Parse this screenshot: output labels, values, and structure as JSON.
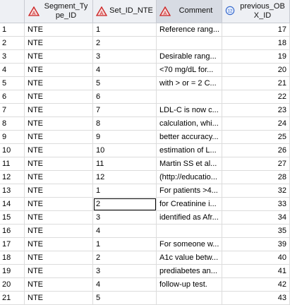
{
  "columns": [
    {
      "label": "Segment_Type_ID",
      "line1": "Segment_Ty",
      "line2": "pe_ID",
      "icon": "triangle-char-icon",
      "icon_color": "#cc2222"
    },
    {
      "label": "Set_ID_NTE",
      "line1": "Set_ID_NTE",
      "line2": "",
      "icon": "triangle-char-icon",
      "icon_color": "#cc2222"
    },
    {
      "label": "Comment",
      "line1": "Comment",
      "line2": "",
      "icon": "triangle-char-icon",
      "icon_color": "#cc2222"
    },
    {
      "label": "previous_OBX_ID",
      "line1": "previous_OB",
      "line2": "X_ID",
      "icon": "numeric-icon",
      "icon_color": "#3366cc"
    }
  ],
  "rows": [
    {
      "n": "1",
      "seg": "NTE",
      "set": "1",
      "comment": "Reference rang...",
      "prev": "17"
    },
    {
      "n": "2",
      "seg": "NTE",
      "set": "2",
      "comment": "",
      "prev": "18"
    },
    {
      "n": "3",
      "seg": "NTE",
      "set": "3",
      "comment": "Desirable rang...",
      "prev": "19"
    },
    {
      "n": "4",
      "seg": "NTE",
      "set": "4",
      "comment": "<70 mg/dL for...",
      "prev": "20"
    },
    {
      "n": "5",
      "seg": "NTE",
      "set": "5",
      "comment": "with > or = 2 C...",
      "prev": "21"
    },
    {
      "n": "6",
      "seg": "NTE",
      "set": "6",
      "comment": "",
      "prev": "22"
    },
    {
      "n": "7",
      "seg": "NTE",
      "set": "7",
      "comment": "LDL-C is now c...",
      "prev": "23"
    },
    {
      "n": "8",
      "seg": "NTE",
      "set": "8",
      "comment": "calculation, whi...",
      "prev": "24"
    },
    {
      "n": "9",
      "seg": "NTE",
      "set": "9",
      "comment": "better accuracy...",
      "prev": "25"
    },
    {
      "n": "10",
      "seg": "NTE",
      "set": "10",
      "comment": "estimation of L...",
      "prev": "26"
    },
    {
      "n": "11",
      "seg": "NTE",
      "set": "11",
      "comment": "Martin SS et al...",
      "prev": "27"
    },
    {
      "n": "12",
      "seg": "NTE",
      "set": "12",
      "comment": "(http://educatio...",
      "prev": "28"
    },
    {
      "n": "13",
      "seg": "NTE",
      "set": "1",
      "comment": "For patients >4...",
      "prev": "32"
    },
    {
      "n": "14",
      "seg": "NTE",
      "set": "2",
      "comment": "for Creatinine i...",
      "prev": "33"
    },
    {
      "n": "15",
      "seg": "NTE",
      "set": "3",
      "comment": "identified as Afr...",
      "prev": "34"
    },
    {
      "n": "16",
      "seg": "NTE",
      "set": "4",
      "comment": "",
      "prev": "35"
    },
    {
      "n": "17",
      "seg": "NTE",
      "set": "1",
      "comment": "For someone w...",
      "prev": "39"
    },
    {
      "n": "18",
      "seg": "NTE",
      "set": "2",
      "comment": "A1c value betw...",
      "prev": "40"
    },
    {
      "n": "19",
      "seg": "NTE",
      "set": "3",
      "comment": "prediabetes an...",
      "prev": "41"
    },
    {
      "n": "20",
      "seg": "NTE",
      "set": "4",
      "comment": "follow-up test.",
      "prev": "42"
    },
    {
      "n": "21",
      "seg": "NTE",
      "set": "5",
      "comment": "",
      "prev": "43"
    }
  ],
  "focused_cell": {
    "row_index": 13,
    "column": "Set_ID_NTE"
  },
  "selected_column": "Comment"
}
